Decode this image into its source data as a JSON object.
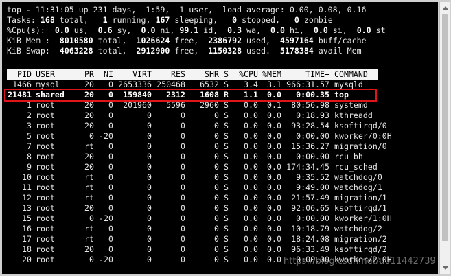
{
  "summary": [
    "top - 11:31:05 up 231 days,  1:59,  1 user,  load average: 0.00, 0.08, 0.16",
    "Tasks: 168 total,   1 running, 167 sleeping,   0 stopped,   0 zombie",
    "%Cpu(s):  0.0 us,  0.6 sy,  0.0 ni, 99.1 id,  0.3 wa,  0.0 hi,  0.0 si,  0.0 st",
    "KiB Mem :  8010580 total,  1026624 free,  2386792 used,  4597164 buff/cache",
    "KiB Swap:  4063228 total,  2912900 free,  1150328 used.  5178384 avail Mem"
  ],
  "columns": [
    "PID",
    "USER",
    "PR",
    "NI",
    "VIRT",
    "RES",
    "SHR",
    "S",
    "%CPU",
    "%MEM",
    "TIME+",
    "COMMAND"
  ],
  "processes": [
    [
      "1466",
      "mysql",
      "20",
      "0",
      "2653336",
      "250468",
      "6532",
      "S",
      "3.4",
      "3.1",
      "966:31.57",
      "mysqld"
    ],
    [
      "21481",
      "shared",
      "20",
      "0",
      "159840",
      "2312",
      "1608",
      "R",
      "1.1",
      "0.0",
      "0:00.35",
      "top"
    ],
    [
      "1",
      "root",
      "20",
      "0",
      "201960",
      "5596",
      "2960",
      "S",
      "0.0",
      "0.1",
      "80:56.98",
      "systemd"
    ],
    [
      "2",
      "root",
      "20",
      "0",
      "0",
      "0",
      "0",
      "S",
      "0.0",
      "0.0",
      "0:18.93",
      "kthreadd"
    ],
    [
      "3",
      "root",
      "20",
      "0",
      "0",
      "0",
      "0",
      "S",
      "0.0",
      "0.0",
      "93:28.54",
      "ksoftirqd/0"
    ],
    [
      "5",
      "root",
      "0",
      "-20",
      "0",
      "0",
      "0",
      "S",
      "0.0",
      "0.0",
      "0:00.00",
      "kworker/0:0H"
    ],
    [
      "7",
      "root",
      "rt",
      "0",
      "0",
      "0",
      "0",
      "S",
      "0.0",
      "0.0",
      "15:36.27",
      "migration/0"
    ],
    [
      "8",
      "root",
      "20",
      "0",
      "0",
      "0",
      "0",
      "S",
      "0.0",
      "0.0",
      "0:00.00",
      "rcu_bh"
    ],
    [
      "9",
      "root",
      "20",
      "0",
      "0",
      "0",
      "0",
      "S",
      "0.0",
      "0.0",
      "174:34.45",
      "rcu_sched"
    ],
    [
      "10",
      "root",
      "rt",
      "0",
      "0",
      "0",
      "0",
      "S",
      "0.0",
      "0.0",
      "9:35.52",
      "watchdog/0"
    ],
    [
      "11",
      "root",
      "rt",
      "0",
      "0",
      "0",
      "0",
      "S",
      "0.0",
      "0.0",
      "9:49.00",
      "watchdog/1"
    ],
    [
      "12",
      "root",
      "rt",
      "0",
      "0",
      "0",
      "0",
      "S",
      "0.0",
      "0.0",
      "21:57.49",
      "migration/1"
    ],
    [
      "13",
      "root",
      "20",
      "0",
      "0",
      "0",
      "0",
      "S",
      "0.0",
      "0.0",
      "92:06.65",
      "ksoftirqd/1"
    ],
    [
      "15",
      "root",
      "0",
      "-20",
      "0",
      "0",
      "0",
      "S",
      "0.0",
      "0.0",
      "0:00.00",
      "kworker/1:0H"
    ],
    [
      "16",
      "root",
      "rt",
      "0",
      "0",
      "0",
      "0",
      "S",
      "0.0",
      "0.0",
      "10:18.79",
      "watchdog/2"
    ],
    [
      "17",
      "root",
      "rt",
      "0",
      "0",
      "0",
      "0",
      "S",
      "0.0",
      "0.0",
      "18:24.08",
      "migration/2"
    ],
    [
      "18",
      "root",
      "20",
      "0",
      "0",
      "0",
      "0",
      "S",
      "0.0",
      "0.0",
      "96:33.49",
      "ksoftirqd/2"
    ],
    [
      "20",
      "root",
      "0",
      "-20",
      "0",
      "0",
      "0",
      "S",
      "0.0",
      "0.0",
      "0:00.00",
      "kworker/2:0H"
    ]
  ],
  "highlighted_pid": "21481",
  "watermark": "https://blog.csdn.net/u011442739",
  "colors": {
    "terminal_bg": "#000000",
    "text": "#e8e8e8",
    "header_bar": "#f4f4f4",
    "highlight_box": "#e0141b"
  }
}
